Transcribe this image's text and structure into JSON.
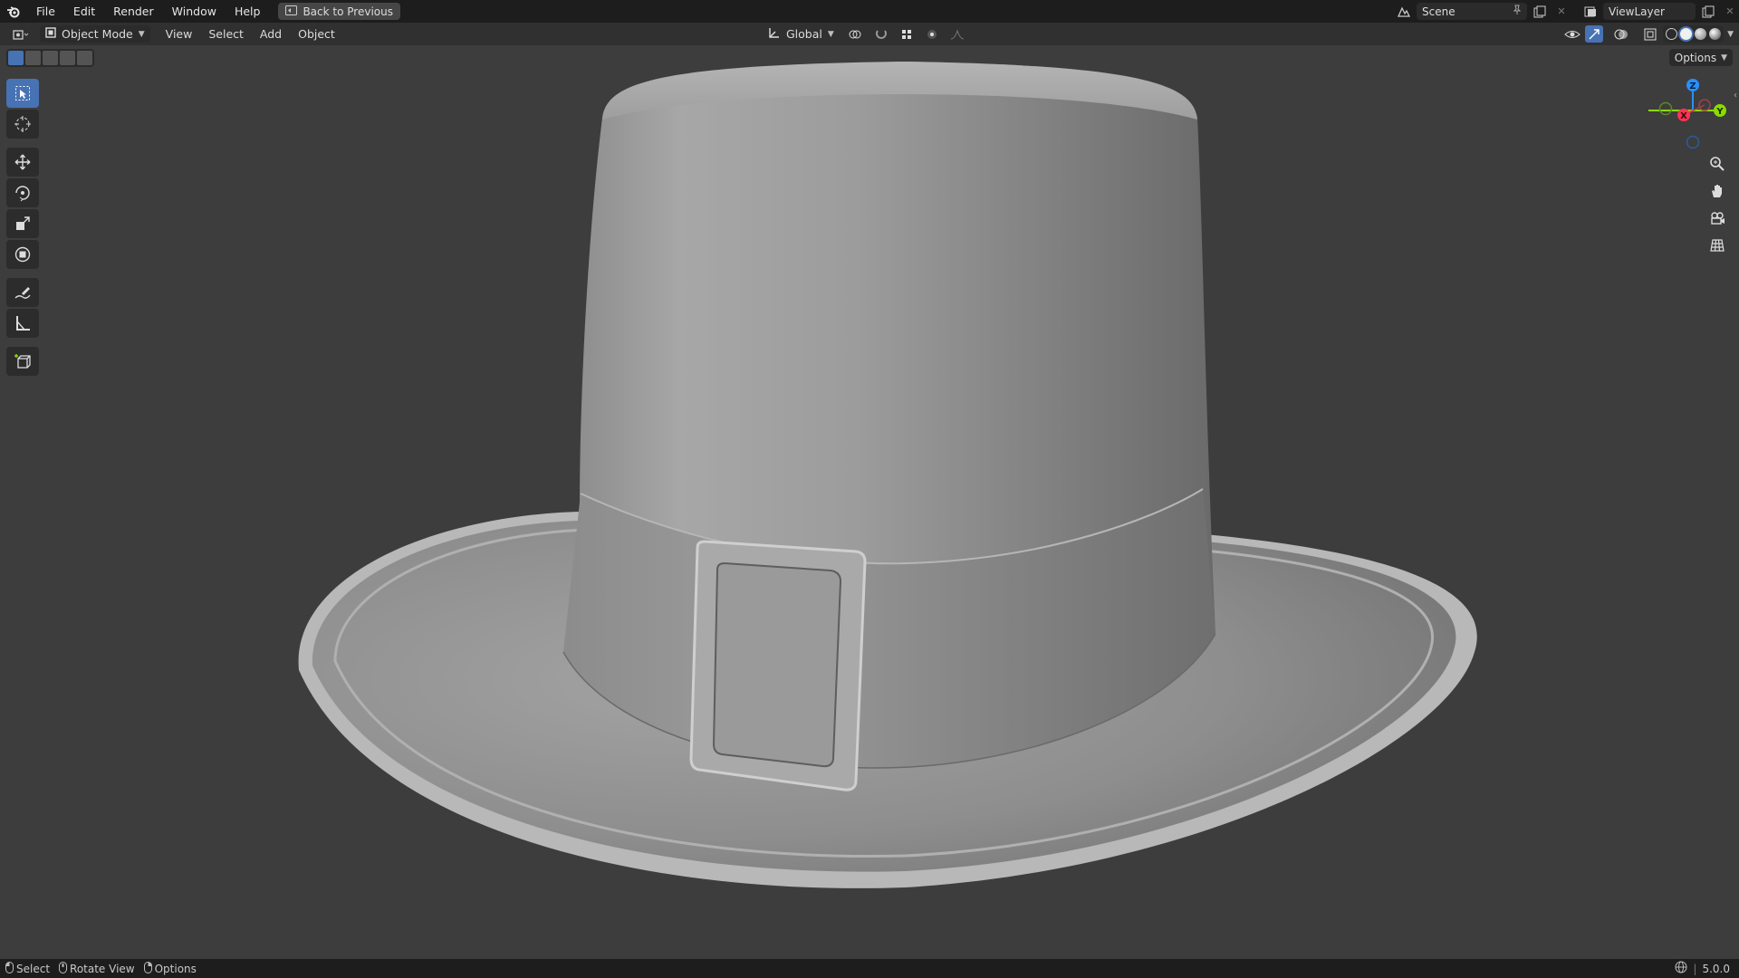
{
  "topbar": {
    "menus": [
      "File",
      "Edit",
      "Render",
      "Window",
      "Help"
    ],
    "back_label": "Back to Previous",
    "scene_name": "Scene",
    "view_layer": "ViewLayer"
  },
  "header": {
    "mode_label": "Object Mode",
    "menus": [
      "View",
      "Select",
      "Add",
      "Object"
    ],
    "transform_orientation": "Global",
    "options_label": "Options"
  },
  "gizmo": {
    "z": "Z",
    "x": "X",
    "y": "Y"
  },
  "statusbar": {
    "select": "Select",
    "rotate_view": "Rotate View",
    "options": "Options",
    "version": "5.0.0"
  },
  "colors": {
    "accent": "#4772b3",
    "axis_x": "#ff3352",
    "axis_y": "#8bdc00",
    "axis_z": "#2890ff",
    "viewport_bg": "#3d3d3d"
  },
  "icons": [
    "blender-logo-icon",
    "select-box-icon",
    "cursor-icon",
    "move-icon",
    "rotate-icon",
    "scale-icon",
    "transform-icon",
    "annotate-icon",
    "measure-icon",
    "add-cube-icon",
    "zoom-icon",
    "hand-icon",
    "camera-icon",
    "grid-icon"
  ]
}
